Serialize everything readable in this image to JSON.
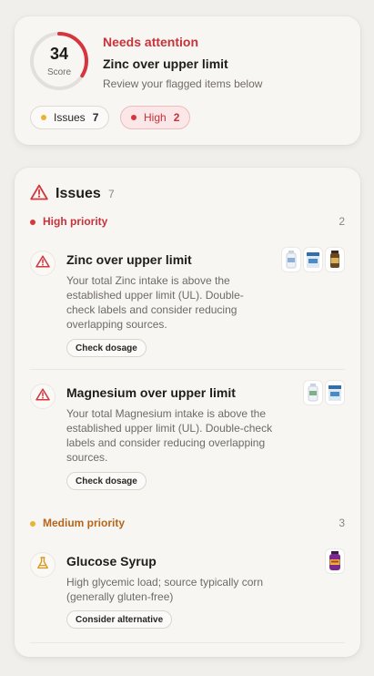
{
  "score": {
    "value": "34",
    "label": "Score",
    "fraction": 0.34,
    "ring_color": "#d6353d",
    "status": "Needs attention",
    "headline": "Zinc over upper limit",
    "subtitle": "Review your flagged items below"
  },
  "pills": {
    "issues": {
      "label": "Issues",
      "count": "7",
      "dot_color": "#e9b433"
    },
    "high": {
      "label": "High",
      "count": "2",
      "dot_color": "#d7363e"
    }
  },
  "issues": {
    "title": "Issues",
    "count": "7",
    "icon": "warning-triangle-icon",
    "groups": [
      {
        "label": "High priority",
        "count": "2",
        "color": "#c6333b",
        "items": [
          {
            "title": "Zinc over upper limit",
            "description": "Your total Zinc intake is above the established upper limit (UL). Double-check labels and consider reducing overlapping sources.",
            "action": "Check dosage",
            "icon": "warning-triangle-icon",
            "products": [
              "white-bottle-icon",
              "blue-box-icon",
              "brown-bottle-icon"
            ]
          },
          {
            "title": "Magnesium over upper limit",
            "description": "Your total Magnesium intake is above the established upper limit (UL). Double-check labels and consider reducing overlapping sources.",
            "action": "Check dosage",
            "icon": "warning-triangle-icon",
            "products": [
              "white-bottle-icon",
              "blue-box-icon"
            ]
          }
        ]
      },
      {
        "label": "Medium priority",
        "count": "3",
        "color": "#b3661c",
        "items": [
          {
            "title": "Glucose Syrup",
            "description": "High glycemic load; source typically corn (generally gluten-free)",
            "action": "Consider alternative",
            "icon": "flask-icon",
            "products": [
              "purple-bottle-icon"
            ]
          }
        ]
      }
    ]
  }
}
